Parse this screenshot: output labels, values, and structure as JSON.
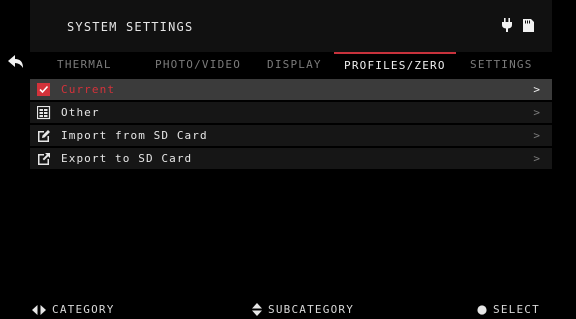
{
  "header": {
    "title": "SYSTEM SETTINGS",
    "icons": [
      "plug-icon",
      "sd-card-icon"
    ]
  },
  "tabs": [
    {
      "label": "THERMAL",
      "active": false
    },
    {
      "label": "PHOTO/VIDEO",
      "active": false
    },
    {
      "label": "DISPLAY",
      "active": false
    },
    {
      "label": "PROFILES/ZERO",
      "active": true
    },
    {
      "label": "SETTINGS",
      "active": false
    }
  ],
  "list": [
    {
      "label": "Current",
      "icon": "checkbox-icon",
      "selected": true,
      "chevron": ">"
    },
    {
      "label": "Other",
      "icon": "grid-icon",
      "selected": false,
      "chevron": ">"
    },
    {
      "label": "Import from SD Card",
      "icon": "edit-icon",
      "selected": false,
      "chevron": ">"
    },
    {
      "label": "Export to SD Card",
      "icon": "export-icon",
      "selected": false,
      "chevron": ">"
    }
  ],
  "footer": {
    "category": "CATEGORY",
    "subcategory": "SUBCATEGORY",
    "select": "SELECT"
  },
  "colors": {
    "accent": "#c8323c",
    "selected_row": "#3b3b3b",
    "row": "#161616"
  }
}
